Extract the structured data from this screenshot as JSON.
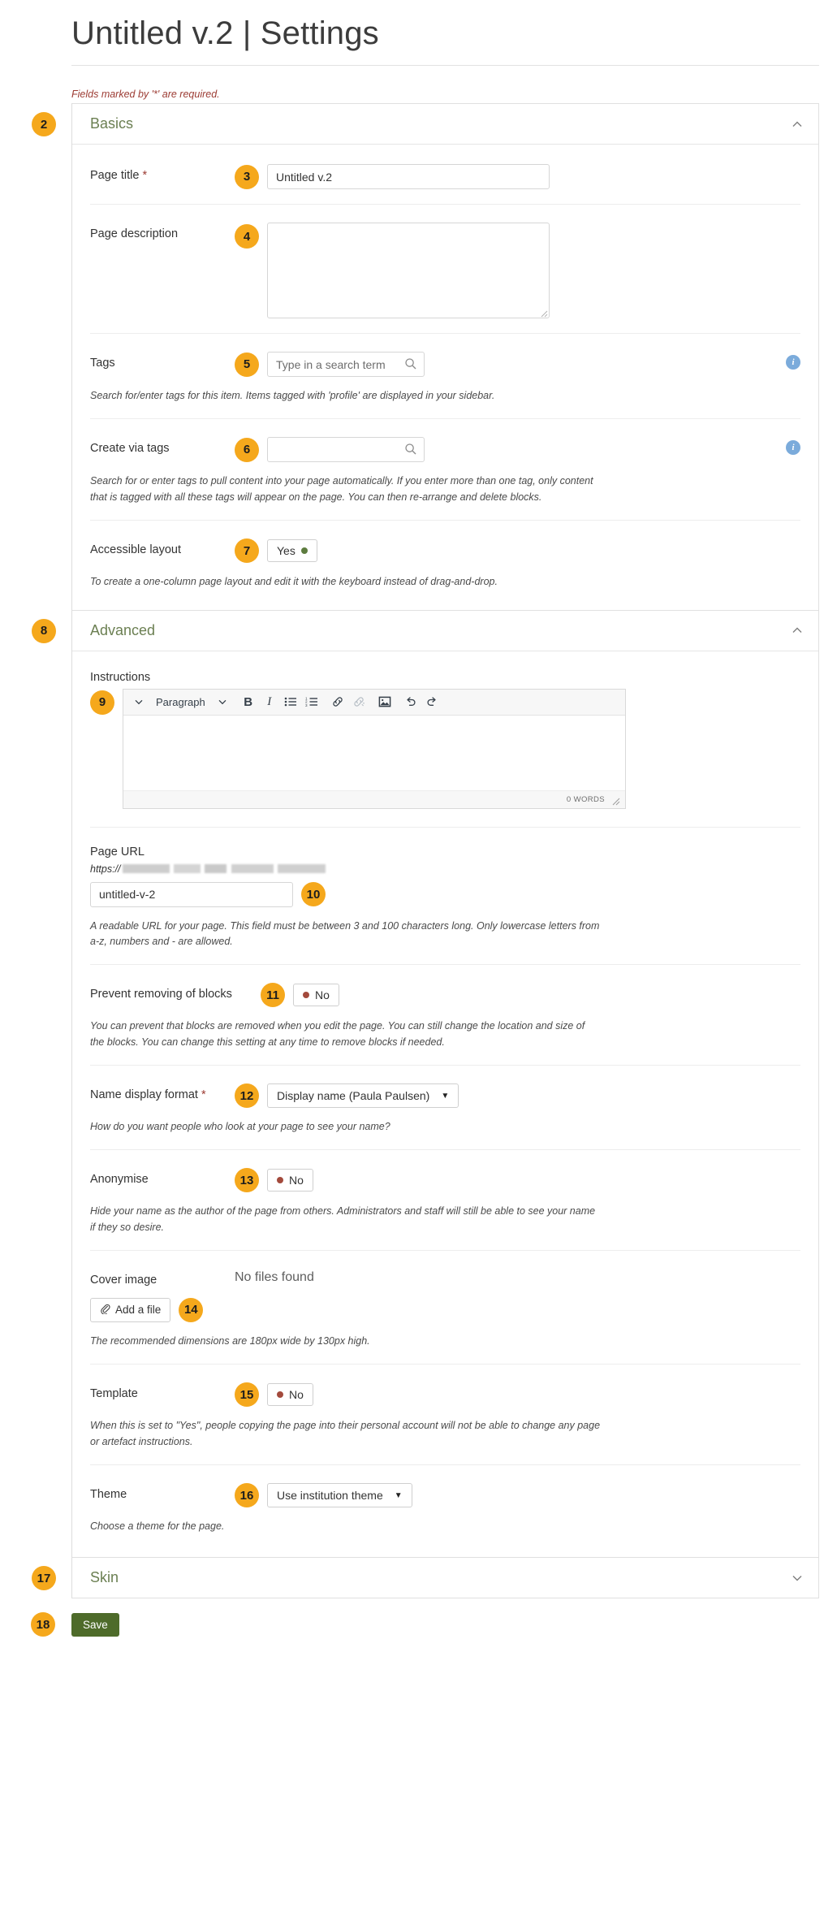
{
  "header": {
    "title": "Untitled v.2 | Settings"
  },
  "required_note": "Fields marked by '*' are required.",
  "steps": {
    "basics": "2",
    "page_title": "3",
    "page_description": "4",
    "tags": "5",
    "create_via_tags": "6",
    "accessible_layout": "7",
    "advanced": "8",
    "instructions": "9",
    "page_url": "10",
    "prevent_removing": "11",
    "name_display": "12",
    "anonymise": "13",
    "cover_image": "14",
    "template": "15",
    "theme": "16",
    "skin": "17",
    "save": "18"
  },
  "panels": {
    "basics": {
      "title": "Basics",
      "chevron": "chevron-up-icon"
    },
    "advanced": {
      "title": "Advanced",
      "chevron": "chevron-up-icon"
    },
    "skin": {
      "title": "Skin",
      "chevron": "chevron-down-icon"
    }
  },
  "fields": {
    "page_title": {
      "label": "Page title",
      "required_mark": "*",
      "value": "Untitled v.2"
    },
    "page_description": {
      "label": "Page description",
      "value": ""
    },
    "tags": {
      "label": "Tags",
      "placeholder": "Type in a search term",
      "value": "",
      "help": "Search for/enter tags for this item. Items tagged with 'profile' are displayed in your sidebar.",
      "info_icon": "info-icon"
    },
    "create_via_tags": {
      "label": "Create via tags",
      "placeholder": "",
      "value": "",
      "help": "Search for or enter tags to pull content into your page automatically. If you enter more than one tag, only content that is tagged with all these tags will appear on the page. You can then re-arrange and delete blocks.",
      "info_icon": "info-icon"
    },
    "accessible_layout": {
      "label": "Accessible layout",
      "value": "Yes",
      "state": "on",
      "help": "To create a one-column page layout and edit it with the keyboard instead of drag-and-drop."
    },
    "instructions": {
      "label": "Instructions",
      "content": "",
      "wordcount": "0 WORDS",
      "toolbar": [
        {
          "icon": "chevron-down-icon",
          "label": ""
        },
        {
          "icon": "paragraph-style-dropdown",
          "label": "Paragraph"
        },
        {
          "icon": "chevron-down-icon",
          "label": ""
        },
        {
          "icon": "bold-icon",
          "label": "B"
        },
        {
          "icon": "italic-icon",
          "label": "I"
        },
        {
          "icon": "bullet-list-icon",
          "label": ""
        },
        {
          "icon": "numbered-list-icon",
          "label": ""
        },
        {
          "icon": "link-icon",
          "label": ""
        },
        {
          "icon": "unlink-icon",
          "label": ""
        },
        {
          "icon": "image-icon",
          "label": ""
        },
        {
          "icon": "undo-icon",
          "label": ""
        },
        {
          "icon": "redo-icon",
          "label": ""
        }
      ]
    },
    "page_url": {
      "label": "Page URL",
      "protocol": "https://",
      "value": "untitled-v-2",
      "help": "A readable URL for your page. This field must be between 3 and 100 characters long. Only lowercase letters from a-z, numbers and - are allowed."
    },
    "prevent_removing": {
      "label": "Prevent removing of blocks",
      "value": "No",
      "state": "off",
      "help": "You can prevent that blocks are removed when you edit the page. You can still change the location and size of the blocks. You can change this setting at any time to remove blocks if needed."
    },
    "name_display": {
      "label": "Name display format",
      "required_mark": "*",
      "value": "Display name (Paula Paulsen)",
      "help": "How do you want people who look at your page to see your name?"
    },
    "anonymise": {
      "label": "Anonymise",
      "value": "No",
      "state": "off",
      "help": "Hide your name as the author of the page from others. Administrators and staff will still be able to see your name if they so desire."
    },
    "cover_image": {
      "label": "Cover image",
      "status": "No files found",
      "button": "Add a file",
      "button_icon": "paperclip-icon",
      "help": "The recommended dimensions are 180px wide by 130px high."
    },
    "template": {
      "label": "Template",
      "value": "No",
      "state": "off",
      "help": "When this is set to \"Yes\", people copying the page into their personal account will not be able to change any page or artefact instructions."
    },
    "theme": {
      "label": "Theme",
      "value": "Use institution theme",
      "help": "Choose a theme for the page."
    }
  },
  "save_button": {
    "label": "Save"
  },
  "colors": {
    "accent_badge": "#f5a81c",
    "panel_title": "#6b7f52",
    "required_text": "#9c3b33",
    "save_button": "#4e6b2a",
    "toggle_on": "#5d7c3f",
    "toggle_off": "#a34a3c",
    "info_icon": "#7babdb"
  }
}
